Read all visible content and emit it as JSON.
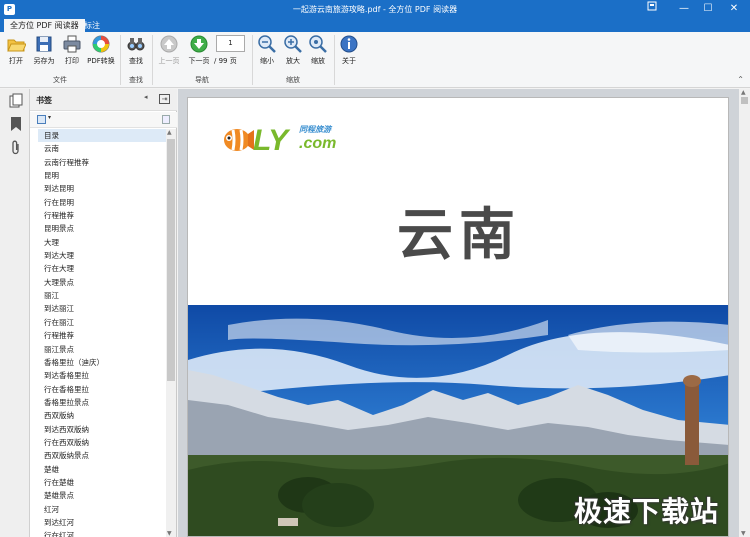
{
  "window": {
    "title": "一起游云南旅游攻略.pdf - 全方位 PDF 阅读器",
    "app_icon_glyph": "P",
    "buttons": {
      "help": "?",
      "minimize": "—",
      "maximize": "☐",
      "close": "✕"
    }
  },
  "ribbon_tabs": [
    {
      "label": "全方位 PDF 阅读器",
      "active": true
    },
    {
      "label": "标注",
      "active": false
    }
  ],
  "ribbon": {
    "buttons": {
      "open": "打开",
      "save_as": "另存为",
      "print": "打印",
      "pdf_convert": "PDF转换",
      "find": "查找",
      "prev_page": "上一页",
      "next_page": "下一页",
      "zoom_out": "缩小",
      "zoom_in": "放大",
      "zoom": "缩放",
      "about": "关于"
    },
    "groups": {
      "file": "文件",
      "find": "查找",
      "navigation": "导航",
      "zoom": "缩放"
    },
    "page_input": "1",
    "page_count": "/ 99 页",
    "expand_glyph": "⌃"
  },
  "sidebar": {
    "title": "书签",
    "collapse_glyph": "◂",
    "close_glyph": "⇥",
    "bookmarks": [
      "目录",
      "云南",
      "云南行程推荐",
      "昆明",
      "到达昆明",
      "行在昆明",
      "行程推荐",
      "昆明景点",
      "大理",
      "到达大理",
      "行在大理",
      "大理景点",
      "丽江",
      "到达丽江",
      "行在丽江",
      "行程推荐",
      "丽江景点",
      "香格里拉（迪庆）",
      "到达香格里拉",
      "行在香格里拉",
      "香格里拉景点",
      "西双版纳",
      "到达西双版纳",
      "行在西双版纳",
      "西双版纳景点",
      "楚雄",
      "行在楚雄",
      "楚雄景点",
      "红河",
      "到达红河",
      "行在红河"
    ],
    "selected_index": 0
  },
  "document": {
    "logo": {
      "ly": "LY",
      "com": ".com",
      "cn": "同程旅游"
    },
    "cover_title": "云南"
  },
  "watermark": "极速下载站",
  "colors": {
    "titlebar": "#1b6fc7",
    "logo_green": "#7ab92c",
    "logo_blue": "#3a8fd0",
    "selected_row": "#ddeaf7"
  }
}
